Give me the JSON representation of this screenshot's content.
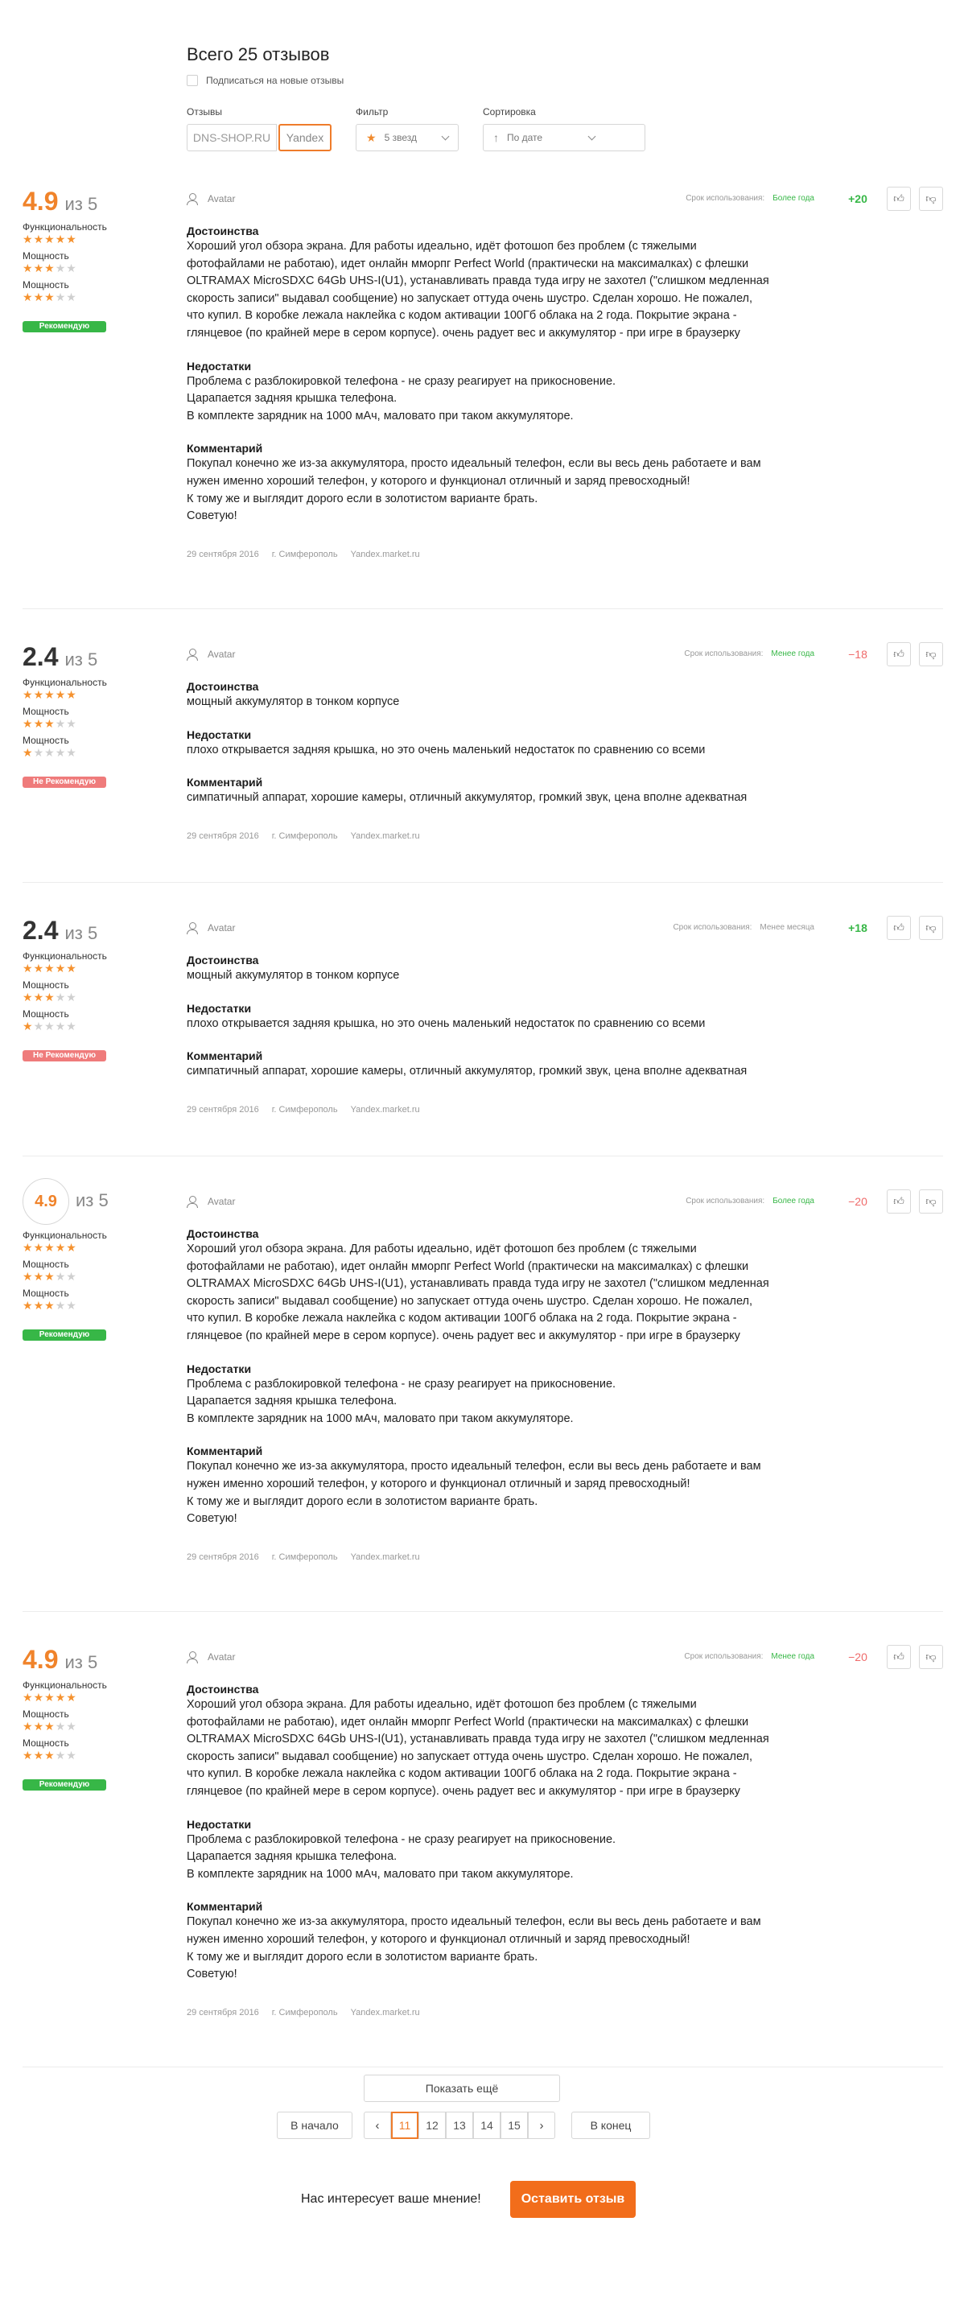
{
  "header": {
    "title": "Всего 25 отзывов",
    "subscribe_label": "Подписаться на новые отзывы"
  },
  "filters": {
    "source_label": "Отзывы",
    "source_options": [
      "DNS-SHOP.RU",
      "Yandex"
    ],
    "source_selected": "Yandex",
    "filter_label": "Фильтр",
    "filter_value": "5 звезд",
    "sort_label": "Сортировка",
    "sort_value": "По дате"
  },
  "labels": {
    "of": "из 5",
    "criteria": [
      "Функциональность",
      "Мощность",
      "Мощность"
    ],
    "usage_prefix": "Срок использования:",
    "pros": "Достоинства",
    "cons": "Недостатки",
    "comment": "Комментарий",
    "avatar": "Avatar"
  },
  "reviews": [
    {
      "score": "4.9",
      "score_style": "orange",
      "criteria_ratings": [
        5,
        3,
        3
      ],
      "badge": "Рекомендую",
      "badge_type": "good",
      "usage": "Более года",
      "usage_color": "green",
      "votes": "+20",
      "votes_type": "pos",
      "pros": "Хороший угол обзора экрана. Для работы идеально, идёт фотошоп без проблем (с тяжелыми\nфотофайлами не работаю), идет онлайн ммор­пг Perfect World (практически на максималках) с флешки\nOLTRAMAX MicroSDXC 64Gb UHS-I(U1), устанавливать правда туда игру не захотел (\"слишком медленная\nскорость записи\" выдавал сообщение) но запускает оттуда очень шустро. Сделан хорошо. Не пожалел,\nчто купил. В коробке лежала наклейка с кодом активации 100Гб облака на 2 года. Покрытие экрана -\nглянцевое (по крайней мере в сером корпусе). очень радует вес и аккумулятор - при игре в браузерку",
      "cons": "Проблема с разблокировкой телефона - не сразу реагирует на прикосновение.\nЦарапается задняя крышка телефона.\nВ комплекте зарядник на 1000 мАч, маловато при таком аккумуляторе.",
      "comment": "Покупал конечно же из-за аккумулятора, просто идеальный телефон, если вы весь день работаете и вам\nнужен именно хороший телефон, у которого и функционал отличный и заряд превосходный!\nК тому же и выглядит дорого если в золотистом варианте брать.\nСоветую!",
      "date": "29 сентября 2016",
      "city": "г. Симферополь",
      "source": "Yandex.market.ru"
    },
    {
      "score": "2.4",
      "score_style": "dark",
      "criteria_ratings": [
        5,
        3,
        1
      ],
      "badge": "Не Рекомендую",
      "badge_type": "bad",
      "usage": "Менее года",
      "usage_color": "green",
      "votes": "−18",
      "votes_type": "neg",
      "pros": "мощный аккумулятор в тонком корпусе",
      "cons": "плохо открывается задняя крышка, но это очень маленький недостаток по сравнению со всеми",
      "comment": "симпатичный аппарат, хорошие камеры, отличный аккумулятор, громкий звук, цена вполне адекватная",
      "date": "29 сентября 2016",
      "city": "г. Симферополь",
      "source": "Yandex.market.ru"
    },
    {
      "score": "2.4",
      "score_style": "dark",
      "criteria_ratings": [
        5,
        3,
        1
      ],
      "badge": "Не Рекомендую",
      "badge_type": "bad",
      "usage": "Менее месяца",
      "usage_color": "gray",
      "votes": "+18",
      "votes_type": "pos",
      "pros": "мощный аккумулятор в тонком корпусе",
      "cons": "плохо открывается задняя крышка, но это очень маленький недостаток по сравнению со всеми",
      "comment": "симпатичный аппарат, хорошие камеры, отличный аккумулятор, громкий звук, цена вполне адекватная",
      "date": "29 сентября 2016",
      "city": "г. Симферополь",
      "source": "Yandex.market.ru"
    },
    {
      "score": "4.9",
      "score_style": "circle",
      "criteria_ratings": [
        5,
        3,
        3
      ],
      "badge": "Рекомендую",
      "badge_type": "good",
      "usage": "Более года",
      "usage_color": "green",
      "votes": "−20",
      "votes_type": "neg",
      "pros": "Хороший угол обзора экрана. Для работы идеально, идёт фотошоп без проблем (с тяжелыми\nфотофайлами не работаю), идет онлайн ммор­пг Perfect World (практически на максималках) с флешки\nOLTRAMAX MicroSDXC 64Gb UHS-I(U1), устанавливать правда туда игру не захотел (\"слишком медленная\nскорость записи\" выдавал сообщение) но запускает оттуда очень шустро. Сделан хорошо. Не пожалел,\nчто купил. В коробке лежала наклейка с кодом активации 100Гб облака на 2 года. Покрытие экрана -\nглянцевое (по крайней мере в сером корпусе). очень радует вес и аккумулятор - при игре в браузерку",
      "cons": "Проблема с разблокировкой телефона - не сразу реагирует на прикосновение.\nЦарапается задняя крышка телефона.\nВ комплекте зарядник на 1000 мАч, маловато при таком аккумуляторе.",
      "comment": "Покупал конечно же из-за аккумулятора, просто идеальный телефон, если вы весь день работаете и вам\nнужен именно хороший телефон, у которого и функционал отличный и заряд превосходный!\nК тому же и выглядит дорого если в золотистом варианте брать.\nСоветую!",
      "date": "29 сентября 2016",
      "city": "г. Симферополь",
      "source": "Yandex.market.ru"
    },
    {
      "score": "4.9",
      "score_style": "orange",
      "criteria_ratings": [
        5,
        3,
        3
      ],
      "badge": "Рекомендую",
      "badge_type": "good",
      "usage": "Менее года",
      "usage_color": "green",
      "votes": "−20",
      "votes_type": "neg",
      "pros": "Хороший угол обзора экрана. Для работы идеально, идёт фотошоп без проблем (с тяжелыми\nфотофайлами не работаю), идет онлайн ммор­пг Perfect World (практически на максималках) с флешки\nOLTRAMAX MicroSDXC 64Gb UHS-I(U1), устанавливать правда туда игру не захотел (\"слишком медленная\nскорость записи\" выдавал сообщение) но запускает оттуда очень шустро. Сделан хорошо. Не пожалел,\nчто купил. В коробке лежала наклейка с кодом активации 100Гб облака на 2 года. Покрытие экрана -\nглянцевое (по крайней мере в сером корпусе). очень радует вес и аккумулятор - при игре в браузерку",
      "cons": "Проблема с разблокировкой телефона - не сразу реагирует на прикосновение.\nЦарапается задняя крышка телефона.\nВ комплекте зарядник на 1000 мАч, маловато при таком аккумуляторе.",
      "comment": "Покупал конечно же из-за аккумулятора, просто идеальный телефон, если вы весь день работаете и вам\nнужен именно хороший телефон, у которого и функционал отличный и заряд превосходный!\nК тому же и выглядит дорого если в золотистом варианте брать.\nСоветую!",
      "date": "29 сентября 2016",
      "city": "г. Симферополь",
      "source": "Yandex.market.ru"
    }
  ],
  "pagination": {
    "show_more": "Показать ещё",
    "first": "В начало",
    "last": "В конец",
    "pages": [
      "11",
      "12",
      "13",
      "14",
      "15"
    ],
    "active": "11",
    "prev_icon": "chevron-left",
    "next_icon": "chevron-right"
  },
  "cta": {
    "text": "Нас интересует ваше мнение!",
    "button": "Оставить отзыв"
  },
  "colors": {
    "accent": "#f26d1b",
    "star": "#f5922f",
    "positive": "#37b747",
    "negative": "#ef6a6a"
  }
}
